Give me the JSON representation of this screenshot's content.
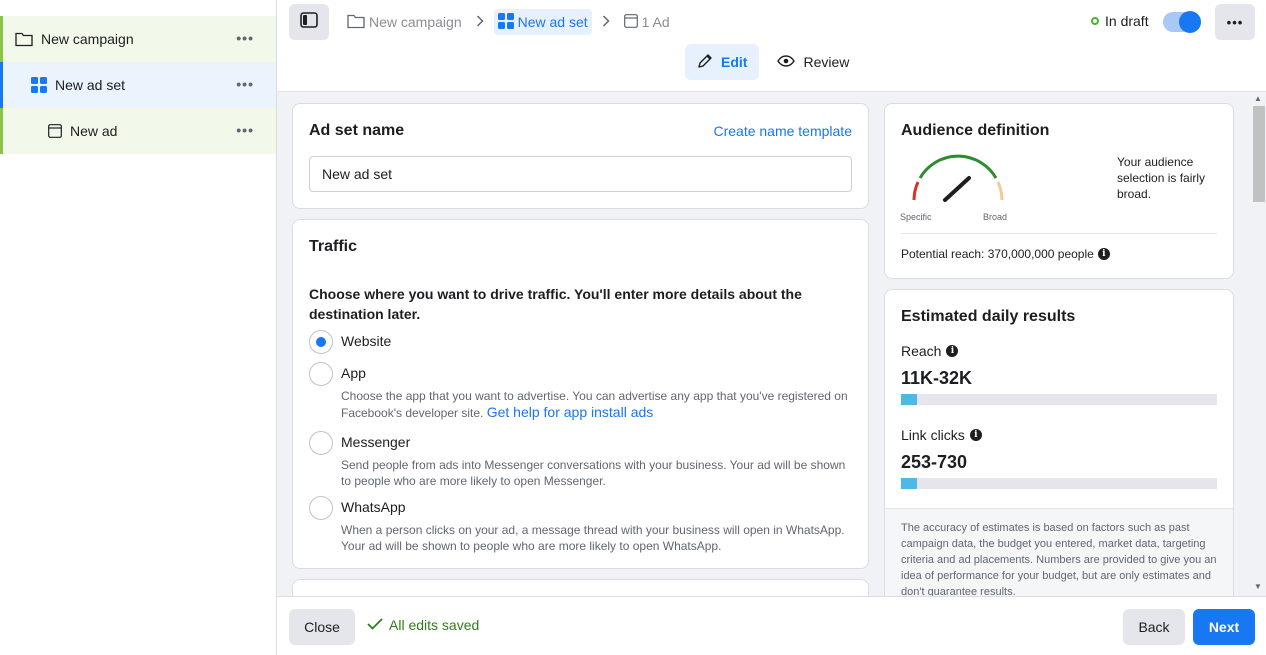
{
  "sidebar": {
    "items": [
      {
        "label": "New campaign",
        "icon": "folder-icon"
      },
      {
        "label": "New ad set",
        "icon": "grid-icon"
      },
      {
        "label": "New ad",
        "icon": "ad-page-icon"
      }
    ],
    "more": "•••"
  },
  "header": {
    "breadcrumb": [
      {
        "label": "New campaign"
      },
      {
        "label": "New ad set"
      },
      {
        "label": "1 Ad"
      }
    ],
    "status": "In draft",
    "more": "•••",
    "tabs": [
      {
        "label": "Edit"
      },
      {
        "label": "Review"
      }
    ]
  },
  "adset_name": {
    "title": "Ad set name",
    "link": "Create name template",
    "value": "New ad set"
  },
  "traffic": {
    "title": "Traffic",
    "question": "Choose where you want to drive traffic. You'll enter more details about the destination later.",
    "options": [
      {
        "label": "Website",
        "desc": "",
        "selected": true
      },
      {
        "label": "App",
        "desc": "Choose the app that you want to advertise. You can advertise any app that you've registered on Facebook's developer site.",
        "link": "Get help for app install ads"
      },
      {
        "label": "Messenger",
        "desc": "Send people from ads into Messenger conversations with your business. Your ad will be shown to people who are more likely to open Messenger."
      },
      {
        "label": "WhatsApp",
        "desc": "When a person clicks on your ad, a message thread with your business will open in WhatsApp. Your ad will be shown to people who are more likely to open WhatsApp."
      }
    ]
  },
  "audience": {
    "title": "Audience definition",
    "specific": "Specific",
    "broad": "Broad",
    "summary": "Your audience selection is fairly broad.",
    "potential_reach": "Potential reach: 370,000,000 people"
  },
  "estimates": {
    "title": "Estimated daily results",
    "reach_label": "Reach",
    "reach_value": "11K-32K",
    "clicks_label": "Link clicks",
    "clicks_value": "253-730",
    "note": "The accuracy of estimates is based on factors such as past campaign data, the budget you entered, market data, targeting criteria and ad placements. Numbers are provided to give you an idea of performance for your budget, but are only estimates and don't guarantee results."
  },
  "footer": {
    "close": "Close",
    "saved": "All edits saved",
    "back": "Back",
    "next": "Next"
  },
  "colors": {
    "accent": "#1877f2",
    "success": "#42b72a",
    "bar_fill": "#4fb8e7"
  }
}
